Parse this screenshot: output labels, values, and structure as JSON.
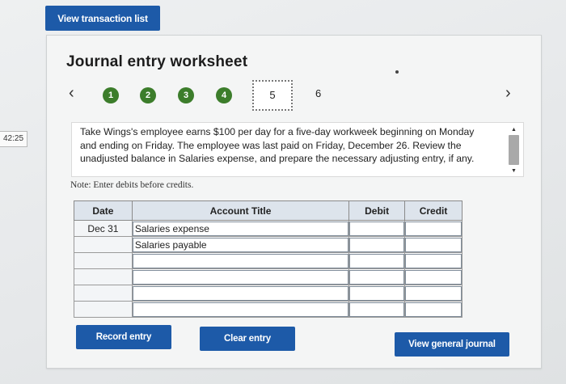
{
  "timer": "42:25",
  "toolbar": {
    "view_transactions_label": "View transaction list"
  },
  "worksheet": {
    "title": "Journal entry worksheet",
    "nav": {
      "prev_icon": "chevron-left-icon",
      "next_icon": "chevron-right-icon"
    },
    "steps": [
      {
        "label": "1",
        "state": "complete"
      },
      {
        "label": "2",
        "state": "complete"
      },
      {
        "label": "3",
        "state": "complete"
      },
      {
        "label": "4",
        "state": "complete"
      },
      {
        "label": "5",
        "state": "current"
      },
      {
        "label": "6",
        "state": "pending"
      }
    ],
    "instructions": "Take Wings's employee earns $100 per day for a five-day workweek beginning on Monday and ending on Friday. The employee was last paid on Friday, December 26. Review the unadjusted balance in Salaries expense, and prepare the necessary adjusting entry, if any.",
    "note": "Note: Enter debits before credits.",
    "colors": {
      "button": "#1d5aa8",
      "step_complete": "#3c7d2b",
      "table_header": "#dde4ec"
    }
  },
  "table": {
    "headers": {
      "date": "Date",
      "account": "Account Title",
      "debit": "Debit",
      "credit": "Credit"
    },
    "rows": [
      {
        "date": "Dec 31",
        "account": "Salaries expense",
        "debit": "",
        "credit": ""
      },
      {
        "date": "",
        "account": "Salaries payable",
        "debit": "",
        "credit": ""
      },
      {
        "date": "",
        "account": "",
        "debit": "",
        "credit": ""
      },
      {
        "date": "",
        "account": "",
        "debit": "",
        "credit": ""
      },
      {
        "date": "",
        "account": "",
        "debit": "",
        "credit": ""
      },
      {
        "date": "",
        "account": "",
        "debit": "",
        "credit": ""
      }
    ]
  },
  "actions": {
    "record_label": "Record entry",
    "clear_label": "Clear entry",
    "view_journal_label": "View general journal"
  }
}
